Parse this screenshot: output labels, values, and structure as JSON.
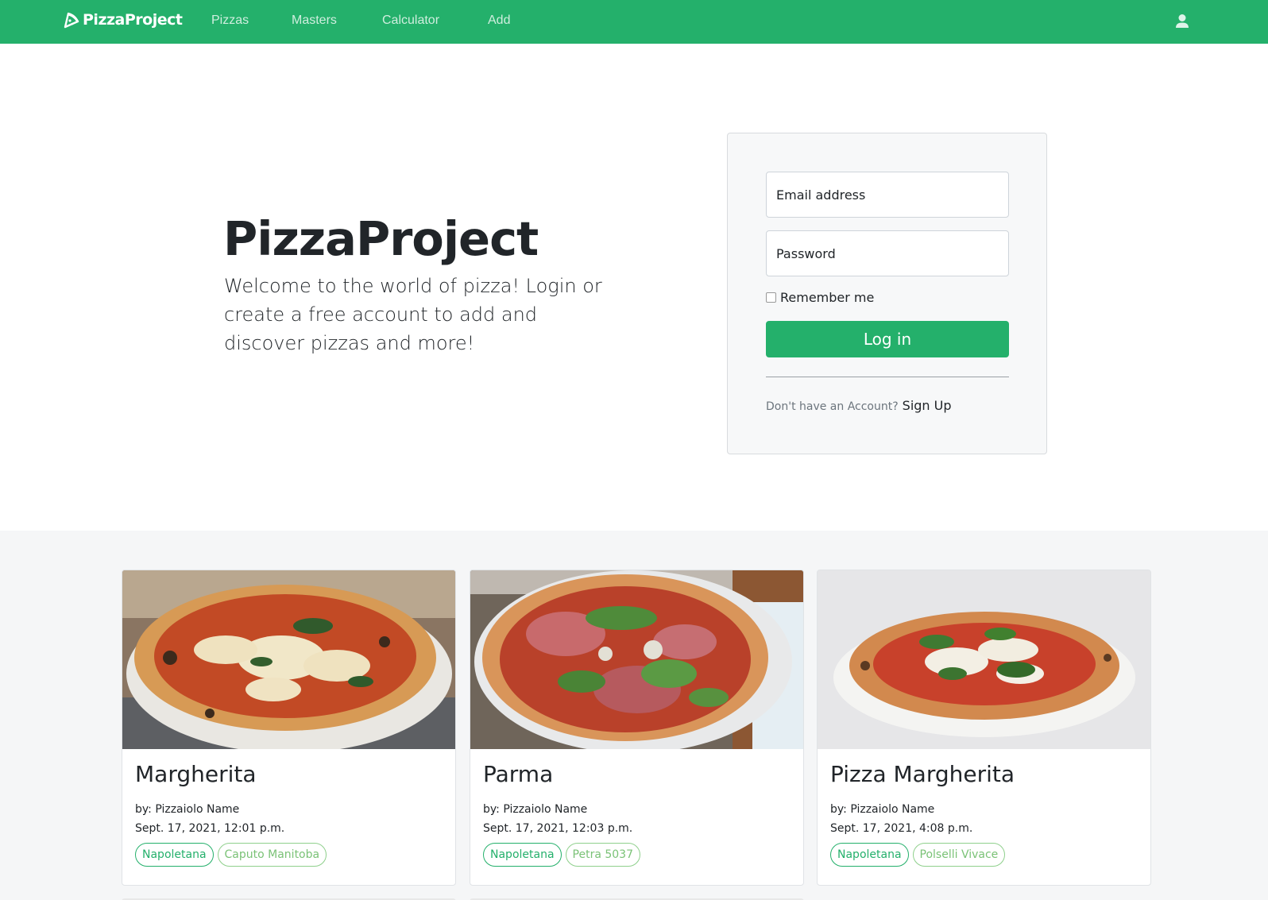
{
  "navbar": {
    "brand": "PizzaProject",
    "links": [
      "Pizzas",
      "Masters",
      "Calculator",
      "Add"
    ]
  },
  "hero": {
    "title": "PizzaProject",
    "text": "Welcome to the world of pizza! Login or create a free account to add and discover pizzas and more!"
  },
  "login": {
    "email_placeholder": "Email address",
    "password_placeholder": "Password",
    "remember_label": "Remember me",
    "button_label": "Log in",
    "signup_question": "Don't have an Account?",
    "signup_link": "Sign Up"
  },
  "cards": [
    {
      "title": "Margherita",
      "author": "by: Pizzaiolo Name",
      "date": "Sept. 17, 2021, 12:01 p.m.",
      "style_tag": "Napoletana",
      "flour_tag": "Caputo Manitoba"
    },
    {
      "title": "Parma",
      "author": "by: Pizzaiolo Name",
      "date": "Sept. 17, 2021, 12:03 p.m.",
      "style_tag": "Napoletana",
      "flour_tag": "Petra 5037"
    },
    {
      "title": "Pizza Margherita",
      "author": "by: Pizzaiolo Name",
      "date": "Sept. 17, 2021, 4:08 p.m.",
      "style_tag": "Napoletana",
      "flour_tag": "Polselli Vivace"
    }
  ],
  "colors": {
    "brand_green": "#24b06b",
    "tag_light_green": "#7ac276"
  },
  "icons": {
    "brand": "pizza-slice-icon",
    "user": "user-icon"
  }
}
